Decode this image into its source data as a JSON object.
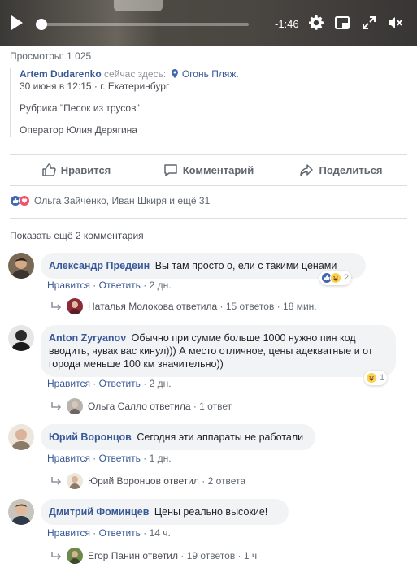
{
  "video": {
    "time_remaining": "-1:46",
    "progress": 0.02,
    "controls": [
      "play-icon",
      "gear-icon",
      "pip-icon",
      "fullscreen-icon",
      "volume-muted-icon"
    ]
  },
  "views": "Просмотры: 1 025",
  "post": {
    "author": "Artem Dudarenko",
    "status_text": "сейчас здесь:",
    "location": "Огонь Пляж.",
    "date_line": "30 июня в 12:15 · г. Екатеринбург",
    "line1": "Рубрика \"Песок из трусов\"",
    "line2": "Оператор Юлия Дерягина"
  },
  "actions": {
    "like": "Нравится",
    "comment": "Комментарий",
    "share": "Поделиться"
  },
  "reactions": {
    "text": "Ольга Зайченко, Иван Шкиря и ещё 31",
    "icons": [
      "like-icon",
      "love-icon"
    ]
  },
  "more_comments": "Показать ещё 2 комментария",
  "colors": {
    "link": "#385898",
    "bubble": "#f2f3f5",
    "meta": "#606770",
    "like": "#4267b2",
    "love": "#f25268",
    "haha": "#fbd24d"
  },
  "comments": [
    {
      "author": "Александр Предеин",
      "text": "Вы там просто о, ели с такими ценами",
      "like": "Нравится",
      "reply": "Ответить",
      "time": "2 дн.",
      "reaction_count": "2",
      "reply_summary": {
        "who": "Наталья Молокова ответила",
        "count": "15 ответов",
        "time": "18 мин."
      }
    },
    {
      "author": "Anton Zyryanov",
      "text": "Обычно при сумме больше 1000 нужно пин код вводить, чувак вас кинул))) А место отличное, цены адекватные и от города меньше 100 км значительно))",
      "like": "Нравится",
      "reply": "Ответить",
      "time": "2 дн.",
      "reaction_count": "1",
      "reply_summary": {
        "who": "Ольга Салло ответила",
        "count": "1 ответ"
      }
    },
    {
      "author": "Юрий Воронцов",
      "text": "Сегодня эти аппараты не работали",
      "like": "Нравится",
      "reply": "Ответить",
      "time": "1 дн.",
      "reply_summary": {
        "who": "Юрий Воронцов ответил",
        "count": "2 ответа"
      }
    },
    {
      "author": "Дмитрий Фоминцев",
      "text": "Цены реально высокие!",
      "like": "Нравится",
      "reply": "Ответить",
      "time": "14 ч.",
      "reply_summary": {
        "who": "Егор Панин ответил",
        "count": "19 ответов",
        "time": "1 ч"
      }
    }
  ]
}
